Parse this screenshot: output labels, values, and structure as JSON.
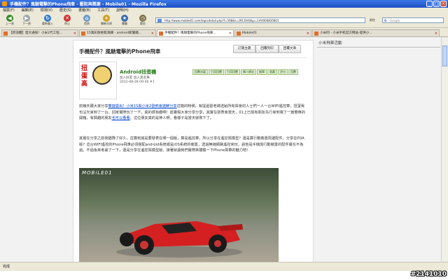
{
  "window": {
    "title": "手機配件？風馳電擊的Phone飛車 - 壓阻與獎謝 - Mobile01 - Mozilla Firefox",
    "minimize": "_",
    "maximize": "□",
    "close": "×"
  },
  "menu": [
    "檔案(F)",
    "編輯(E)",
    "檢視(V)",
    "歷史(S)",
    "書籤(B)",
    "工具(T)",
    "說明(H)"
  ],
  "nav": {
    "back": "上一頁",
    "forward": "下一頁",
    "reload": "重新載入",
    "stop": "停止",
    "home": "首頁",
    "newtab": "開新分頁",
    "bookmarks": "書籤",
    "history": "歷史",
    "url": "http://www.mobile01.com/topicdetail.php?f=568&t=2913040&p=1#4000835801",
    "go": "前往",
    "search_placeholder": "Google"
  },
  "tabs": [
    {
      "label": "【新浪體】發大通知！小米2代工程..."
    },
    {
      "label": "15萬彩妝輕鬆演練 - android新聞總..."
    },
    {
      "label": "手機配件？風馳電擊的Phone飛車..."
    },
    {
      "label": "Mobile01"
    },
    {
      "label": "小米同 - 小米手机官方网站·提供小..."
    }
  ],
  "article": {
    "title": "手機配件？風馳電擊的Phone飛車",
    "buttons": [
      "訂閱主題",
      "回覆列印",
      "回覆文章"
    ],
    "user": {
      "name": "Android扭蛋機",
      "meta": "加入好友 加入黑名單",
      "date": "2012-08-28 09:40 #1"
    },
    "avatar_text": "扭蛋高",
    "post_tags": [
      "回覆本篇",
      "引用回覆",
      "引用回覆",
      "轉人網站",
      "檢舉",
      "收藏",
      "評分",
      "回覆"
    ],
    "p1": {
      "pre": "前幾天跟大家分享",
      "link1": "雙旋雲出！小米1S與小米2發佈會搶鮮分享",
      "mid": "這篇的時候，有提過雷老總送給所有與會的人士們一人一台WIFI遙控車，扭蛋我也沾光拿到了一台，回家實際玩了一下，真的很有趣啊！趁暑假大家分享分享，其實在發表會當天，01上已經有朋友先行拿到寫了一篇簡單的開箱，有興趣的朋友",
      "link2": "也可以看看",
      "post": "。這位朋友真的是神人啊，看樣子是當天就敗下了。"
    },
    "p2": "其實在分享之前我猶豫了好久，這算到底是要發表在哪一個版，算是遙控車，所以分享在遙控與模型？還是算行動裝置周邊配件，分享在PDA版？這台WIFI遙控的Phone飛車必須搭配android系統或是iOS系統的裝置，透過無線網路遙控來玩，說他是手機與行動裝置的配件實在不為過。不過後來考慮了一下，還是分享在遙控與模型版，接著就讓我們實際來體驗一下Phone飛車的魅力吧！",
    "photo_logo": "MOBiLE01"
  },
  "sidebar": {
    "header": "小米飛車活動"
  },
  "status": "完成",
  "watermark": "#2141010",
  "colors": {
    "title_bar": "#245edb",
    "link": "#0044cc",
    "tag_bg": "#dfeccf",
    "car": "#d42020"
  }
}
